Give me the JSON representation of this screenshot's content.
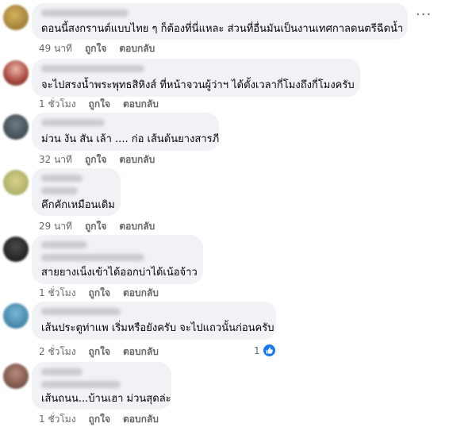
{
  "actions": {
    "like": "ถูกใจ",
    "reply": "ตอบกลับ"
  },
  "more_icon": "more-horizontal-icon",
  "comments": [
    {
      "text": "ดอนนี้สงกรานต์แบบไทย ๆ ก็ต้องที่นี่แหละ ส่วนที่อื่นมันเป็นงานเทศกาลดนตรีฉีดน้ำ",
      "time": "49 นาที"
    },
    {
      "text": "จะไปสรงน้ำพระพุทธสิหิงส์ ที่หน้าจวนผู้ว่าฯ ได้ตั้งเวลากี่โมงถึงกี่โมงครับ",
      "time": "1 ชั่วโมง"
    },
    {
      "text": "ม่วน งัน สัน เล้า .... ก่อ เส้นต้นยางสารภี",
      "time": "32 นาที"
    },
    {
      "text": "คึกคักเหมือนเดิม",
      "time": "29 นาที"
    },
    {
      "text": "สายยางเน็งเข้าได้ออกบ่าได้เน้อจ้าว",
      "time": "1 ชั่วโมง"
    },
    {
      "text": "เส้นประตูท่าแพ เริ่มหรือยังครับ จะไปแถวนั้นก่อนครับ",
      "time": "2 ชั่วโมง",
      "reactions": "1"
    },
    {
      "text": "เส้นถนน...บ้านเฮา ม่วนสุดล่ะ",
      "time": "1 ชั่วโมง"
    }
  ],
  "colors": {
    "like": "#1877f2",
    "bubble": "#f0f2f5",
    "meta": "#65676b"
  }
}
